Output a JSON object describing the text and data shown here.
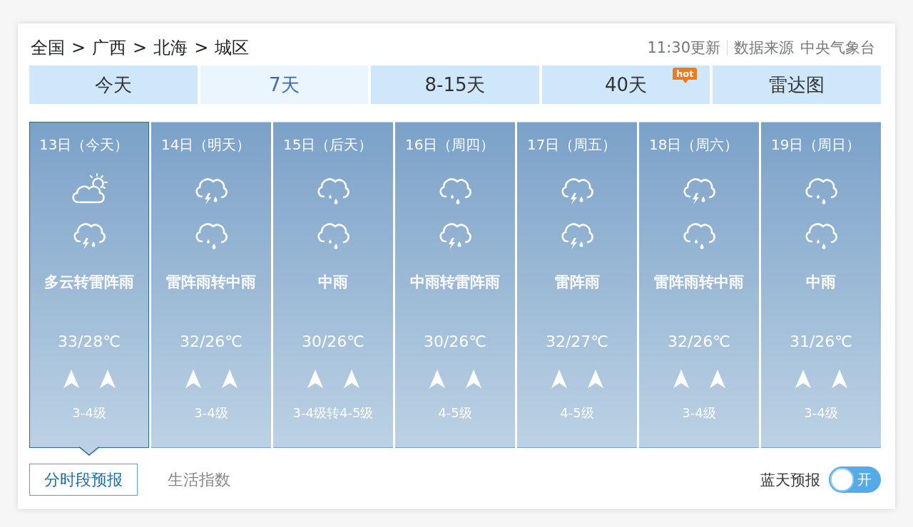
{
  "breadcrumb": {
    "items": [
      "全国",
      "广西",
      "北海",
      "城区"
    ],
    "separators": [
      ">",
      ">",
      ">"
    ]
  },
  "update_info": {
    "time": "11:30更新",
    "source_label": "数据来源",
    "source": "中央气象台"
  },
  "tabs": [
    {
      "label": "今天",
      "selected": false
    },
    {
      "label": "7天",
      "selected": true
    },
    {
      "label": "8-15天",
      "selected": false
    },
    {
      "label": "40天",
      "selected": false,
      "badge": "hot"
    },
    {
      "label": "雷达图",
      "selected": false
    }
  ],
  "days": [
    {
      "date": "13日（今天）",
      "selected": true,
      "icons": [
        {
          "kind": "partly_cloudy"
        },
        {
          "kind": "thunder_rain"
        }
      ],
      "weather": "多云转雷阵雨",
      "temperature": "33/28℃",
      "wind_arrows": [
        {
          "kind": "up"
        },
        {
          "kind": "up"
        }
      ],
      "wind_level": "3-4级"
    },
    {
      "date": "14日（明天）",
      "selected": false,
      "icons": [
        {
          "kind": "thunder_rain"
        },
        {
          "kind": "rain"
        }
      ],
      "weather": "雷阵雨转中雨",
      "temperature": "32/26℃",
      "wind_arrows": [
        {
          "kind": "up"
        },
        {
          "kind": "up"
        }
      ],
      "wind_level": "3-4级"
    },
    {
      "date": "15日（后天）",
      "selected": false,
      "icons": [
        {
          "kind": "rain"
        },
        {
          "kind": "rain"
        }
      ],
      "weather": "中雨",
      "temperature": "30/26℃",
      "wind_arrows": [
        {
          "kind": "up"
        },
        {
          "kind": "up"
        }
      ],
      "wind_level": "3-4级转4-5级"
    },
    {
      "date": "16日（周四）",
      "selected": false,
      "icons": [
        {
          "kind": "rain"
        },
        {
          "kind": "thunder_rain"
        }
      ],
      "weather": "中雨转雷阵雨",
      "temperature": "30/26℃",
      "wind_arrows": [
        {
          "kind": "up"
        },
        {
          "kind": "up"
        }
      ],
      "wind_level": "4-5级"
    },
    {
      "date": "17日（周五）",
      "selected": false,
      "icons": [
        {
          "kind": "thunder_rain"
        },
        {
          "kind": "thunder_rain"
        }
      ],
      "weather": "雷阵雨",
      "temperature": "32/27℃",
      "wind_arrows": [
        {
          "kind": "up"
        },
        {
          "kind": "up"
        }
      ],
      "wind_level": "4-5级"
    },
    {
      "date": "18日（周六）",
      "selected": false,
      "icons": [
        {
          "kind": "thunder_rain"
        },
        {
          "kind": "rain"
        }
      ],
      "weather": "雷阵雨转中雨",
      "temperature": "32/26℃",
      "wind_arrows": [
        {
          "kind": "up"
        },
        {
          "kind": "up"
        }
      ],
      "wind_level": "3-4级"
    },
    {
      "date": "19日（周日）",
      "selected": false,
      "icons": [
        {
          "kind": "rain"
        },
        {
          "kind": "rain"
        }
      ],
      "weather": "中雨",
      "temperature": "31/26℃",
      "wind_arrows": [
        {
          "kind": "up"
        },
        {
          "kind": "up"
        }
      ],
      "wind_level": "3-4级"
    }
  ],
  "bottom_tabs": [
    {
      "label": "分时段预报",
      "selected": true
    },
    {
      "label": "生活指数",
      "selected": false
    }
  ],
  "blue_sky": {
    "label": "蓝天预报",
    "on": true,
    "toggle_text": "开"
  }
}
